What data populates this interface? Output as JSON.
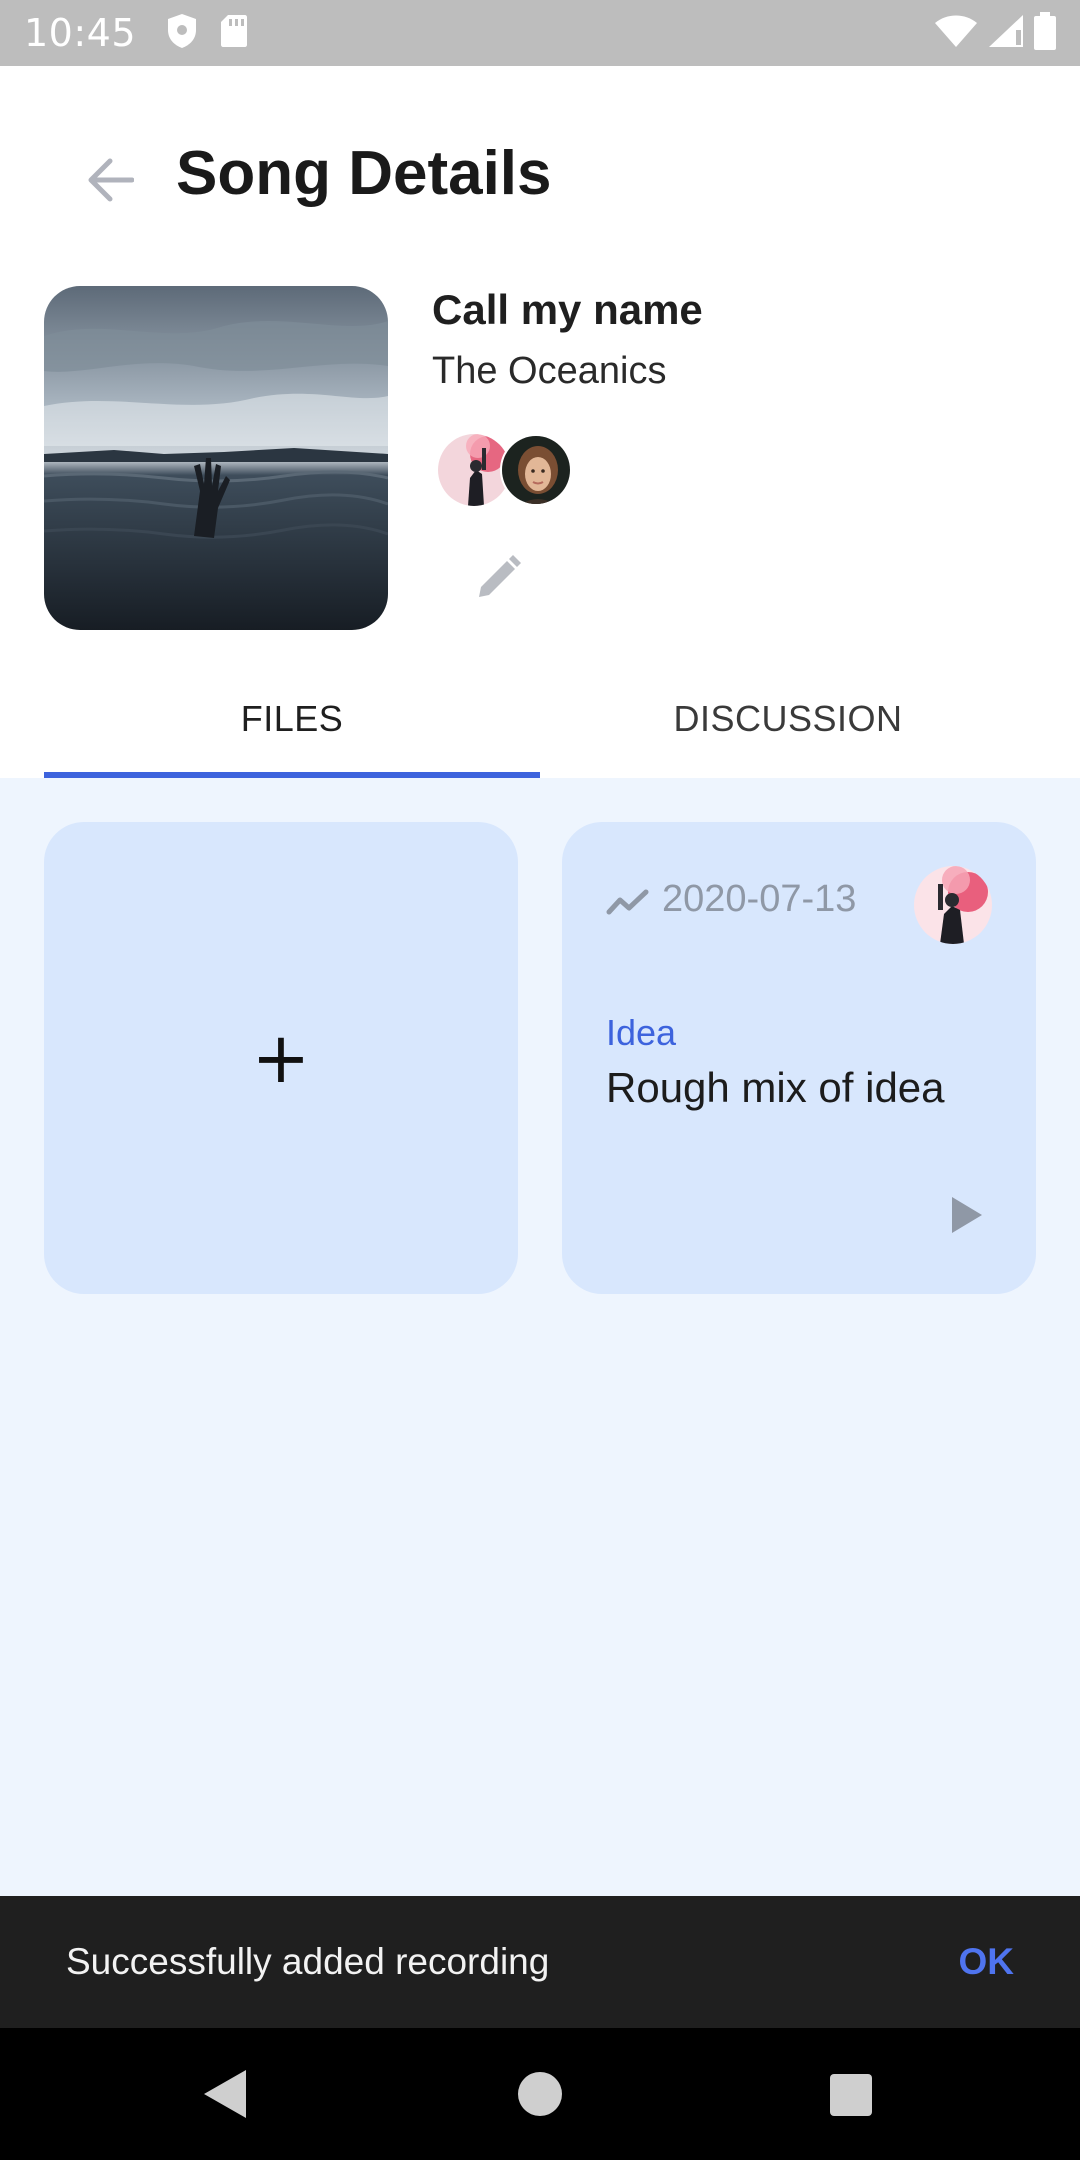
{
  "status_bar": {
    "time": "10:45",
    "icons": [
      "shield-icon",
      "sd-card-icon",
      "wifi-icon",
      "signal-icon",
      "battery-icon"
    ]
  },
  "app_bar": {
    "title": "Song Details",
    "back_icon": "arrow-back-icon"
  },
  "song": {
    "title": "Call my name",
    "artist": "The Oceanics",
    "cover_image": "cover-art-ocean-hand",
    "collaborators": [
      "avatar-smoke-flare",
      "avatar-woman-portrait"
    ],
    "edit_icon": "pencil-icon"
  },
  "tabs": [
    {
      "label": "FILES",
      "selected": true
    },
    {
      "label": "DISCUSSION",
      "selected": false
    }
  ],
  "files": {
    "add_label": "+",
    "items": [
      {
        "date": "2020-07-13",
        "type_icon": "trend-line-icon",
        "tag": "Idea",
        "title": "Rough mix of idea",
        "avatar": "avatar-smoke-flare",
        "play_icon": "play-icon"
      }
    ]
  },
  "snackbar": {
    "message": "Successfully added recording",
    "action": "OK"
  },
  "nav_bar": {
    "icons": [
      "nav-back-icon",
      "nav-home-icon",
      "nav-recents-icon"
    ]
  },
  "colors": {
    "accent": "#3d63dd",
    "content_bg": "#eef5fe",
    "card_bg": "#d8e7fd",
    "snackbar_bg": "#1f1f1f",
    "status_bar_bg": "#bdbdbd"
  }
}
